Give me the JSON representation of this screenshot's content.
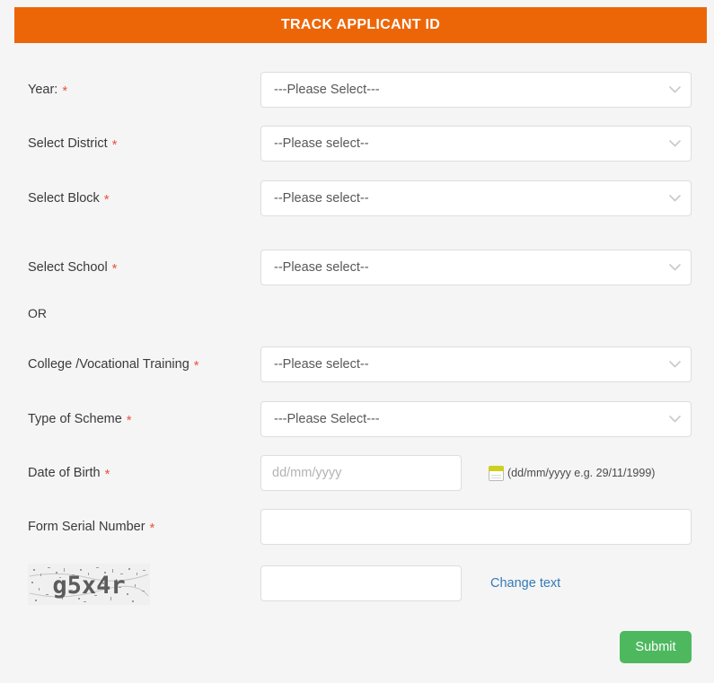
{
  "header": {
    "title": "TRACK APPLICANT ID",
    "background_color": "#ec6608",
    "text_color": "#ffffff"
  },
  "theme": {
    "page_background": "#f5f5f5",
    "accent_orange": "#ec6608",
    "required_asterisk_color": "#e8553c",
    "link_blue": "#337ab7",
    "submit_green": "#4eb85f"
  },
  "form": {
    "required_marker": "*",
    "fields": {
      "year": {
        "label": "Year:",
        "required": true,
        "selected": "---Please Select---"
      },
      "district": {
        "label": "Select District",
        "required": true,
        "selected": "--Please select--"
      },
      "block": {
        "label": "Select Block",
        "required": true,
        "selected": "--Please select--"
      },
      "school": {
        "label": "Select School",
        "required": true,
        "selected": "--Please select--"
      },
      "or_divider": {
        "label": "OR"
      },
      "college": {
        "label": "College /Vocational Training",
        "required": true,
        "selected": "--Please select--"
      },
      "scheme": {
        "label": "Type of Scheme",
        "required": true,
        "selected": "---Please Select---"
      },
      "dob": {
        "label": "Date of Birth",
        "required": true,
        "value": "",
        "placeholder": "dd/mm/yyyy",
        "hint": "(dd/mm/yyyy e.g. 29/11/1999)",
        "icon": "calendar-icon"
      },
      "form_serial": {
        "label": "Form Serial Number",
        "required": true,
        "value": "",
        "placeholder": ""
      },
      "captcha": {
        "image_text": "g5x4r",
        "value": "",
        "placeholder": "",
        "change_link_label": "Change text"
      }
    }
  },
  "actions": {
    "submit_label": "Submit"
  }
}
